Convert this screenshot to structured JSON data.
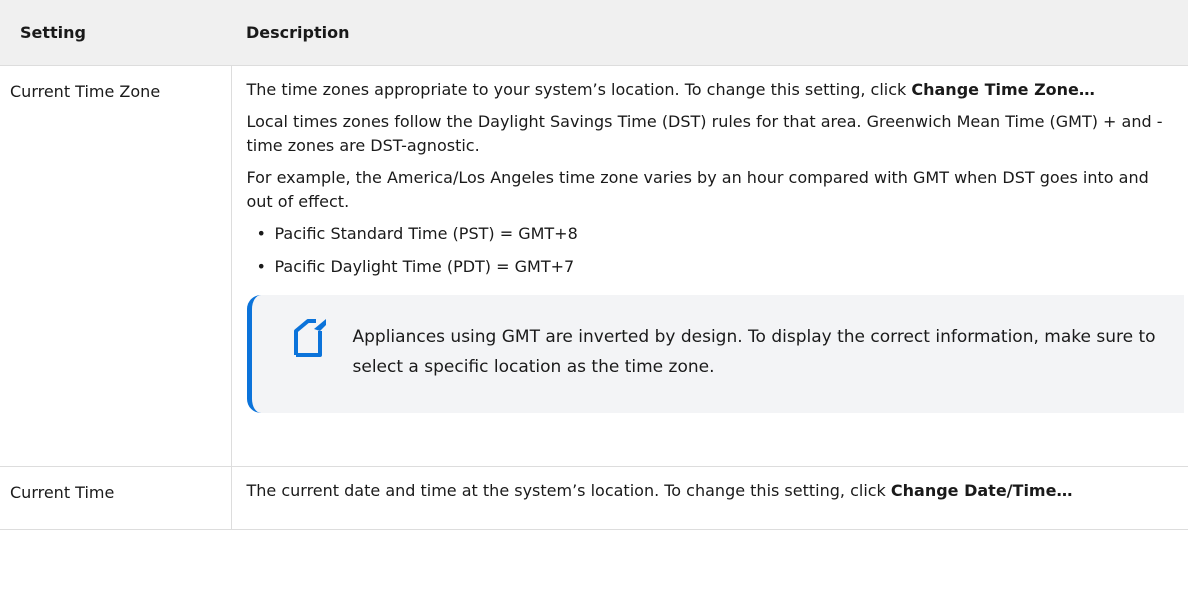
{
  "table": {
    "headers": {
      "setting": "Setting",
      "description": "Description"
    },
    "rows": [
      {
        "setting": "Current Time Zone",
        "desc_p1_text": "The time zones appropriate to your system’s location. To change this setting, click ",
        "desc_p1_bold": "Change Time Zone…",
        "desc_p2": "Local times zones follow the Daylight Savings Time (DST) rules for that area. Greenwich Mean Time (GMT) + and - time zones are DST-agnostic.",
        "desc_p3": "For example, the America/Los Angeles time zone varies by an hour compared with GMT when DST goes into and out of effect.",
        "bullets": [
          "Pacific Standard Time (PST) = GMT+8",
          "Pacific Daylight Time (PDT) = GMT+7"
        ],
        "note": {
          "icon": "note-icon",
          "text": "Appliances using GMT are inverted by design. To display the correct information, make sure to select a specific location as the time zone.",
          "accent": "#0b73da"
        }
      },
      {
        "setting": "Current Time",
        "desc_p1_text": "The current date and time at the system’s location. To change this setting, click ",
        "desc_p1_bold": "Change Date/Time…"
      }
    ]
  }
}
